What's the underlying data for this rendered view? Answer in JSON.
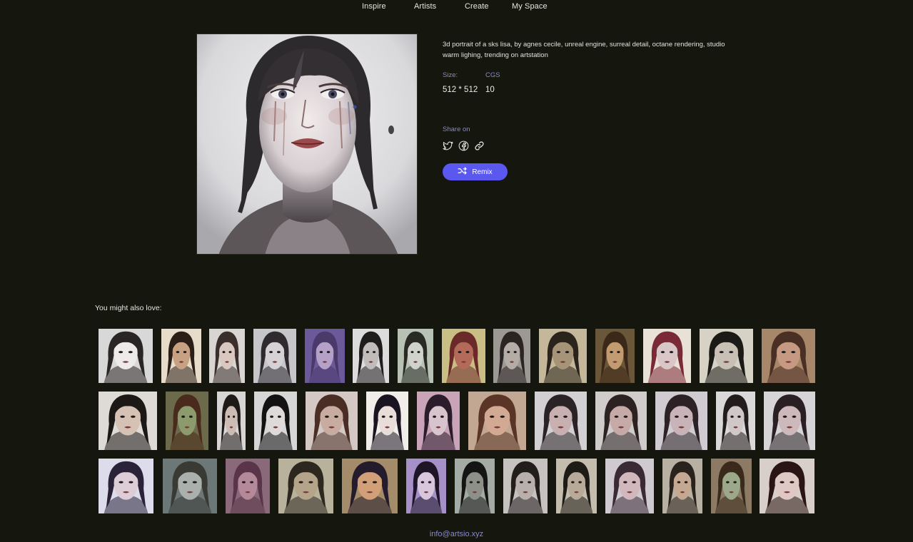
{
  "nav": {
    "items": [
      {
        "label": "Inspire"
      },
      {
        "label": "Artists"
      },
      {
        "label": "Create"
      },
      {
        "label": "My Space"
      }
    ]
  },
  "artwork": {
    "prompt": "3d portrait of a sks lisa, by agnes cecile, unreal engine, surreal detail, octane rendering, studio warm lighing, trending on artstation",
    "size_label": "Size:",
    "size_value": "512 * 512",
    "cgs_label": "CGS",
    "cgs_value": "10"
  },
  "share": {
    "label": "Share on",
    "icons": [
      "twitter-icon",
      "facebook-icon",
      "link-icon"
    ]
  },
  "remix": {
    "label": "Remix",
    "color": "#5b58f0"
  },
  "related": {
    "title": "You might also love:",
    "thumbs": [
      {
        "bg": "#d9d8d8",
        "skin": "#eeeaea",
        "hair": "#2b2626"
      },
      {
        "bg": "#e7dcc9",
        "skin": "#c8a183",
        "hair": "#2b1e16"
      },
      {
        "bg": "#d8d5d2",
        "skin": "#d8c8c0",
        "hair": "#3a2f2a"
      },
      {
        "bg": "#c6c6ca",
        "skin": "#d6d1d5",
        "hair": "#2e2a2e"
      },
      {
        "bg": "#6a5a9a",
        "skin": "#b5a0c8",
        "hair": "#4a3a6a"
      },
      {
        "bg": "#dcdcdc",
        "skin": "#c0bcbc",
        "hair": "#1f1c1c"
      },
      {
        "bg": "#b7c2b4",
        "skin": "#cfd3cc",
        "hair": "#2a2a24"
      },
      {
        "bg": "#c9be84",
        "skin": "#b36a58",
        "hair": "#6b2a2a"
      },
      {
        "bg": "#9c9894",
        "skin": "#b4aca6",
        "hair": "#2a2522"
      },
      {
        "bg": "#c4b79a",
        "skin": "#a59478",
        "hair": "#2a241c"
      },
      {
        "bg": "#6a5638",
        "skin": "#c29c70",
        "hair": "#3c2818"
      },
      {
        "bg": "#e9e1d6",
        "skin": "#d9c7c7",
        "hair": "#7a2a36"
      },
      {
        "bg": "#d6d2c6",
        "skin": "#c8c0b4",
        "hair": "#1c1a16"
      },
      {
        "bg": "#a8866a",
        "skin": "#c69a82",
        "hair": "#4a3024"
      },
      {
        "bg": "#dedad6",
        "skin": "#d6c2b4",
        "hair": "#1c1816"
      },
      {
        "bg": "#6b6a4a",
        "skin": "#8c9a6c",
        "hair": "#4a2a1c"
      },
      {
        "bg": "#d8d6d4",
        "skin": "#ccbcb4",
        "hair": "#1e1a18"
      },
      {
        "bg": "#d6d6d6",
        "skin": "#dedada",
        "hair": "#121212"
      },
      {
        "bg": "#d4c8c4",
        "skin": "#c8aca2",
        "hair": "#4a2e26"
      },
      {
        "bg": "#f1ede8",
        "skin": "#e8ddd8",
        "hair": "#1a1420"
      },
      {
        "bg": "#c9a3b8",
        "skin": "#d8c4cc",
        "hair": "#2a1c2a"
      },
      {
        "bg": "#c2a792",
        "skin": "#d2aa94",
        "hair": "#5a3426"
      },
      {
        "bg": "#d2d0d2",
        "skin": "#c8b0b0",
        "hair": "#2a2224"
      },
      {
        "bg": "#d0cccc",
        "skin": "#c6aaa8",
        "hair": "#2c2222"
      },
      {
        "bg": "#cfcbd0",
        "skin": "#c8b4b8",
        "hair": "#2c2226"
      },
      {
        "bg": "#dad8d8",
        "skin": "#d0c8c8",
        "hair": "#221c1c"
      },
      {
        "bg": "#d6d4d6",
        "skin": "#cdb8bc",
        "hair": "#2a2024"
      },
      {
        "bg": "#dcdcea",
        "skin": "#dccdd6",
        "hair": "#2a2238"
      },
      {
        "bg": "#6c7878",
        "skin": "#aab0ac",
        "hair": "#3a3a34"
      },
      {
        "bg": "#8a6a7a",
        "skin": "#b48a9a",
        "hair": "#5a3448"
      },
      {
        "bg": "#b8b29c",
        "skin": "#b4a48a",
        "hair": "#2c2820"
      },
      {
        "bg": "#a48c6a",
        "skin": "#d2a078",
        "hair": "#241c2c"
      },
      {
        "bg": "#a590c8",
        "skin": "#d8c6dc",
        "hair": "#1e1626"
      },
      {
        "bg": "#a4aaa4",
        "skin": "#8c9088",
        "hair": "#141414"
      },
      {
        "bg": "#c6c2c0",
        "skin": "#b8b0ac",
        "hair": "#221e1c"
      },
      {
        "bg": "#c4bcac",
        "skin": "#b8aa98",
        "hair": "#1e1a16"
      },
      {
        "bg": "#cfcad0",
        "skin": "#d2b8bc",
        "hair": "#3a2a34"
      },
      {
        "bg": "#b8b0a2",
        "skin": "#c4a892",
        "hair": "#2a221c"
      },
      {
        "bg": "#8c7a64",
        "skin": "#9ca88a",
        "hair": "#3a2a1c"
      },
      {
        "bg": "#d8d0c8",
        "skin": "#e0c8c4",
        "hair": "#2a1414"
      }
    ]
  },
  "footer": {
    "email": "info@artsio.xyz"
  }
}
